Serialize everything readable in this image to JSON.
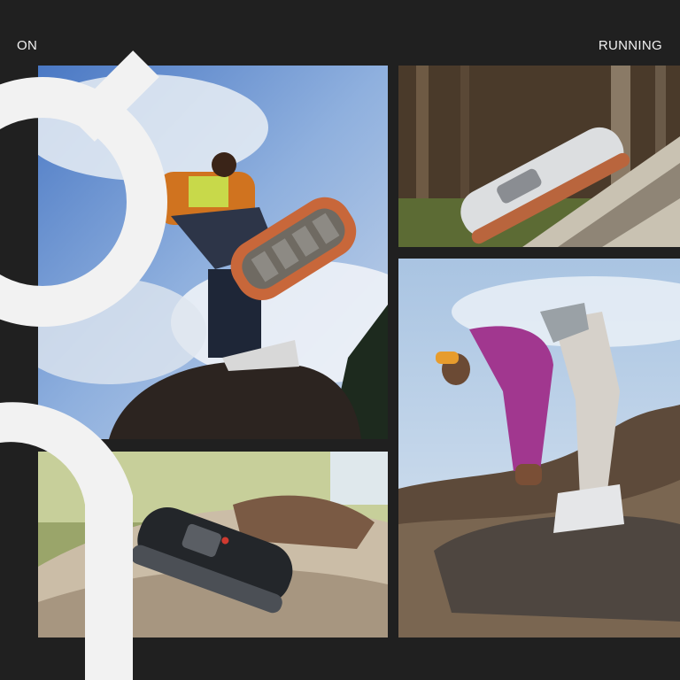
{
  "brand": {
    "left_label": "ON",
    "right_label": "RUNNING"
  },
  "photos": [
    {
      "name": "hiker-sole-closeup-photo"
    },
    {
      "name": "grey-shoe-on-log-photo"
    },
    {
      "name": "purple-hoodie-hiker-photo"
    },
    {
      "name": "black-shoe-on-log-photo"
    }
  ],
  "colors": {
    "background": "#202020",
    "logo": "#f2f2f2",
    "accent_orange": "#c8673a"
  }
}
